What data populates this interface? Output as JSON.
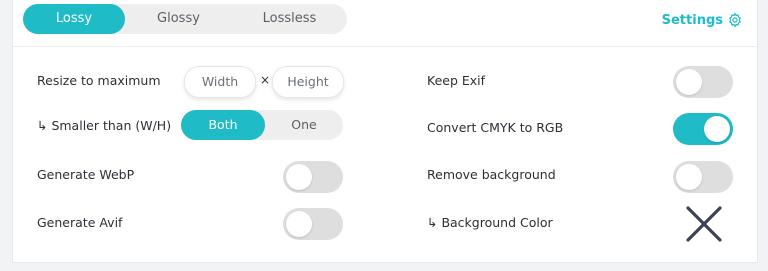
{
  "compression_modes": [
    {
      "label": "Lossy",
      "active": true
    },
    {
      "label": "Glossy",
      "active": false
    },
    {
      "label": "Lossless",
      "active": false
    }
  ],
  "settings": {
    "label": "Settings",
    "icon": "gear-icon"
  },
  "options": {
    "resize": {
      "label": "Resize to maximum",
      "width_placeholder": "Width",
      "height_placeholder": "Height",
      "separator": "×"
    },
    "smaller_than": {
      "label": "↳ Smaller than (W/H)",
      "choices": [
        "Both",
        "One"
      ],
      "selected": "Both"
    },
    "generate_webp": {
      "label": "Generate WebP",
      "enabled": false
    },
    "generate_avif": {
      "label": "Generate Avif",
      "enabled": false
    },
    "keep_exif": {
      "label": "Keep Exif",
      "enabled": false
    },
    "convert_cmyk": {
      "label": "Convert CMYK to RGB",
      "enabled": true
    },
    "remove_background": {
      "label": "Remove background",
      "enabled": false
    },
    "background_color": {
      "label": "↳ Background Color",
      "icon": "close-icon"
    }
  },
  "colors": {
    "accent": "#1fbcc7",
    "toggle_off": "#dedede"
  }
}
